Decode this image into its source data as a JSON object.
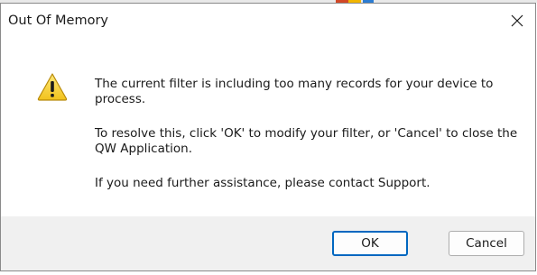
{
  "dialog": {
    "title": "Out Of Memory",
    "close_icon": "close-icon",
    "icon": "warning-icon",
    "messages": [
      "The current filter is including too many records for your device to process.",
      "To resolve this, click 'OK' to modify your filter, or 'Cancel' to close the QW Application.",
      "If you need further assistance, please contact Support."
    ],
    "buttons": {
      "ok_label": "OK",
      "cancel_label": "Cancel"
    }
  },
  "colors": {
    "focus_border": "#0067c0",
    "footer_bg": "#f0f0f0",
    "warning_yellow": "#f7cf2a"
  }
}
